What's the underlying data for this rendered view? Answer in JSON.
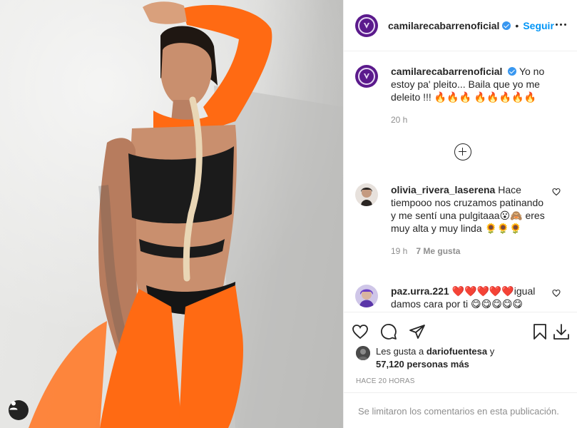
{
  "header": {
    "username": "camilarecabarrenoficial",
    "separator": "•",
    "follow_label": "Seguir"
  },
  "caption": {
    "username": "camilarecabarrenoficial",
    "text": "Yo no estoy pa' pleito... Baila que yo me deleito !!! 🔥🔥🔥 🔥🔥🔥🔥🔥",
    "time": "20 h"
  },
  "comments": [
    {
      "username": "olivia_rivera_laserena",
      "text": "Hace tiempooo nos cruzamos patinando y me sentí una pulgitaaa😮🙈 eres muy alta y muy linda 🌻🌻🌻",
      "time": "19 h",
      "likes": "7 Me gusta"
    },
    {
      "username": "paz.urra.221",
      "text": "❤️❤️❤️❤️❤️igual damos cara por ti 😋😋😋😋😋",
      "time": "",
      "likes": ""
    }
  ],
  "likes": {
    "prefix": "Les gusta a",
    "user": "dariofuentesa",
    "connector": "y",
    "count": "57,120 personas más"
  },
  "post_age": "HACE 20 HORAS",
  "comments_limited": "Se limitaron los comentarios en esta publicación.",
  "icons": {
    "like": "heart-icon",
    "comment": "comment-icon",
    "share": "share-icon",
    "save": "bookmark-icon",
    "download": "download-icon",
    "user_tags": "user-icon",
    "more": "more-icon",
    "load_more": "plus-circle-icon"
  },
  "colors": {
    "accent": "#0095f6",
    "verified": "#3897f0",
    "avatar": "#5b1a8c",
    "outfit": "#ff6a13"
  }
}
